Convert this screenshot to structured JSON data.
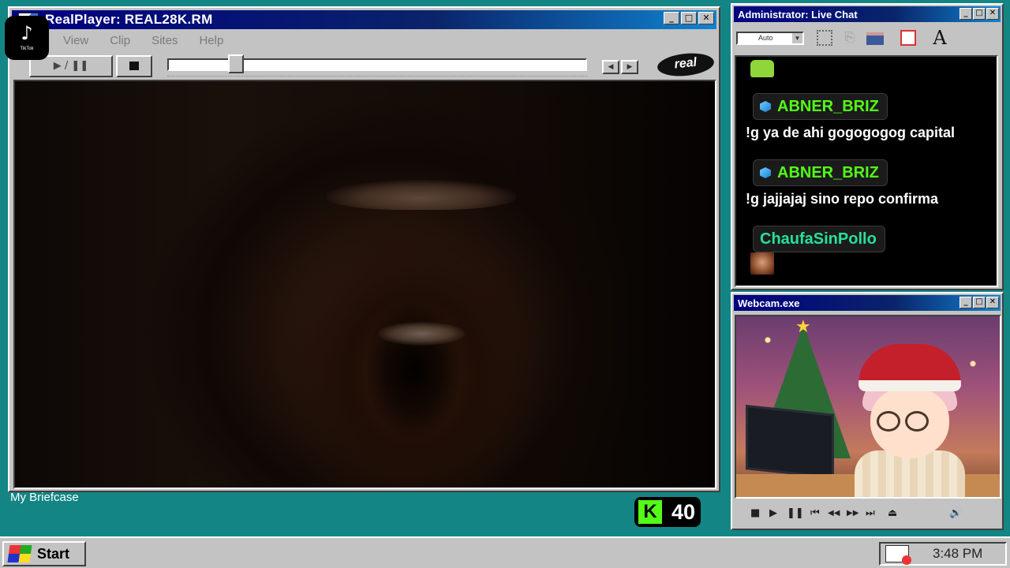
{
  "realplayer": {
    "title": "RealPlayer: REAL28K.RM",
    "window_buttons": [
      "_",
      "□",
      "✕"
    ],
    "menu": [
      "View",
      "Clip",
      "Sites",
      "Help"
    ],
    "play_pause_label": "▶ / ❚❚",
    "seek_progress": 0.15,
    "prev_label": "◀",
    "next_label": "▶",
    "logo_text": "real"
  },
  "desktop": {
    "briefcase_label": "My Briefcase"
  },
  "kick": {
    "logo": "K",
    "viewer_count": "40",
    "accent": "#53fc18"
  },
  "tiktok": {
    "glyph": "♪",
    "label": "TikTok"
  },
  "chat": {
    "title": "Administrator: Live Chat",
    "font_size_value": "Auto",
    "font_tool_label": "A",
    "messages": [
      {
        "user": "ABNER_BRIZ",
        "text": "!g ya de ahi gogogogog capital"
      },
      {
        "user": "ABNER_BRIZ",
        "text": "!g jajjajaj sino repo confirma"
      },
      {
        "user": "ChaufaSinPollo",
        "text": ""
      }
    ]
  },
  "webcam": {
    "title": "Webcam.exe",
    "controls": [
      "■",
      "▶",
      "❚❚",
      "⏮",
      "◀◀",
      "▶▶",
      "⏭",
      "⏏",
      "🔊"
    ]
  },
  "taskbar": {
    "start_label": "Start",
    "clock": "3:48 PM"
  }
}
